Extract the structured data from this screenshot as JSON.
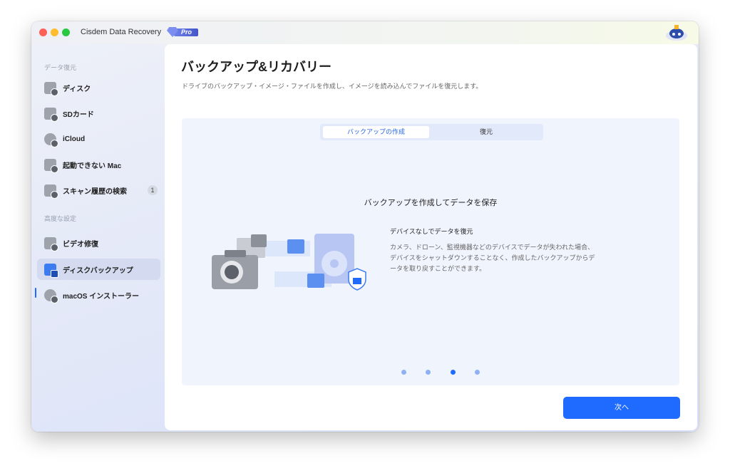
{
  "app": {
    "title": "Cisdem Data Recovery",
    "pro_label": "Pro"
  },
  "sidebar": {
    "section1": "データ復元",
    "items": [
      {
        "label": "ディスク"
      },
      {
        "label": "SDカード"
      },
      {
        "label": "iCloud"
      },
      {
        "label": "起動できない Mac"
      },
      {
        "label": "スキャン履歴の検索",
        "badge": "1"
      }
    ],
    "section2": "高度な設定",
    "items2": [
      {
        "label": "ビデオ修復"
      },
      {
        "label": "ディスクバックアップ",
        "active": true
      },
      {
        "label": "macOS インストーラー"
      }
    ]
  },
  "main": {
    "title": "バックアップ&リカバリー",
    "subtitle": "ドライブのバックアップ・イメージ・ファイルを作成し、イメージを読み込んでファイルを復元します。",
    "tabs": [
      {
        "label": "バックアップの作成",
        "active": true
      },
      {
        "label": "復元"
      }
    ],
    "card_title": "バックアップを作成してデータを保存",
    "feature_title": "デバイスなしでデータを復元",
    "feature_desc": "カメラ、ドローン、監視機器などのデバイスでデータが失われた場合、デバイスをシャットダウンすることなく、作成したバックアップからデータを取り戻すことができます。",
    "carousel": {
      "count": 4,
      "active_index": 3
    },
    "next_label": "次へ"
  },
  "colors": {
    "accent": "#1f6bff"
  }
}
